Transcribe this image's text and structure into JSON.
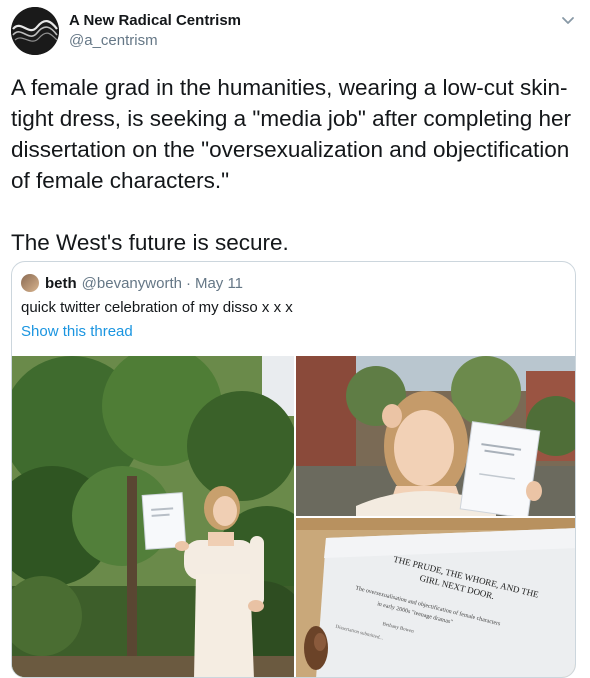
{
  "author": {
    "name": "A New Radical Centrism",
    "handle": "@a_centrism"
  },
  "tweet": {
    "text": "A female grad in the humanities, wearing a low-cut skin-tight dress, is seeking a \"media job\" after completing her dissertation on the \"oversexualization and objectification of female characters.\"\n\nThe West's future is secure."
  },
  "quoted": {
    "name": "beth",
    "handle": "@bevanyworth",
    "separator": "·",
    "date": "May 11",
    "text": "quick twitter celebration of my disso x x x",
    "link_label": "Show this thread"
  },
  "dissertation": {
    "title_line1": "THE PRUDE, THE WHORE, AND THE",
    "title_line2": "GIRL NEXT DOOR.",
    "subtitle_line1": "The oversexualisation and objectification of female characters",
    "subtitle_line2": "in early 2000s \"teenage dramas\"",
    "author_line": "Bethany Bowen",
    "note_line": "Dissertation submitted..."
  },
  "icons": {
    "caret": "chevron-down-icon",
    "avatar": "wave-logo-icon"
  },
  "colors": {
    "text": "#14171a",
    "secondary": "#657786",
    "link": "#1b95e0",
    "border": "#ccd6dd"
  }
}
